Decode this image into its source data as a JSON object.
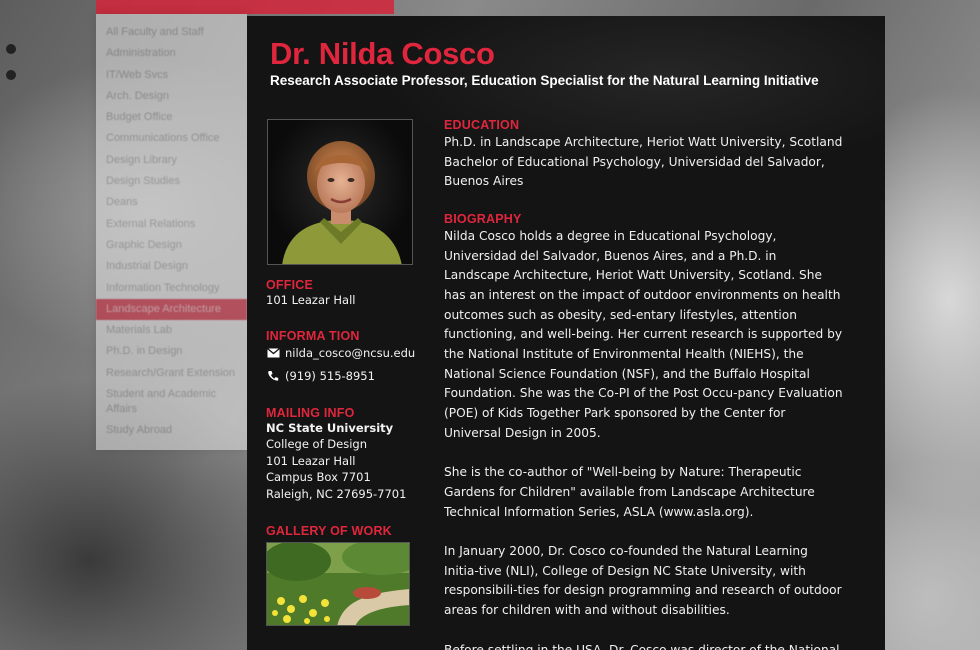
{
  "profile": {
    "name": "Dr. Nilda Cosco",
    "title": "Research Associate Professor, Education Specialist for the Natural Learning Initiative"
  },
  "sidebar": {
    "items": [
      "All Faculty and Staff",
      "Administration",
      "IT/Web Svcs",
      "Arch. Design",
      "Budget Office",
      "Communications Office",
      "Design Library",
      "Design Studies",
      "Deans",
      "External Relations",
      "Graphic Design",
      "Industrial Design",
      "Information Technology",
      "Landscape Architecture",
      "Materials Lab",
      "Ph.D. in Design",
      "Research/Grant Extension",
      "Student and Academic Affairs",
      "Study Abroad"
    ],
    "active_index": 13
  },
  "left": {
    "office_heading": "OFFICE",
    "office_value": "101 Leazar Hall",
    "info_heading": "INFORMA TION",
    "email": "nilda_cosco@ncsu.edu",
    "phone": "(919) 515-8951",
    "mailing_heading": "MAILING INFO",
    "mailing_lines": [
      "NC State University",
      "College of Design",
      "101 Leazar Hall",
      "Campus Box 7701",
      "Raleigh, NC 27695-7701"
    ],
    "gallery_heading": "GALLERY OF WORK"
  },
  "right": {
    "education_heading": "EDUCATION",
    "education_lines": [
      "Ph.D. in Landscape Architecture, Heriot Watt University, Scotland",
      "Bachelor of Educational Psychology, Universidad del Salvador,",
      "Buenos Aires"
    ],
    "biography_heading": "BIOGRAPHY",
    "bio_paragraphs": [
      "Nilda Cosco holds a degree in Educational Psychology, Universidad del Salvador, Buenos Aires, and a Ph.D. in Landscape Architecture, Heriot Watt University, Scotland. She has an interest on the impact of outdoor environments on health outcomes such as obesity, sed-entary lifestyles, attention functioning, and well-being. Her current research is supported by the National Institute of Environmental Health (NIEHS), the National Science Foundation (NSF), and the Buffalo Hospital Foundation. She was the Co-PI of the Post Occu-pancy Evaluation (POE) of Kids Together Park sponsored by the Center for Universal Design in 2005.",
      "She is the co-author of \"Well-being by Nature: Therapeutic Gardens for Children\" available from Landscape Architecture Technical Information Series, ASLA (www.asla.org).",
      "In January 2000, Dr. Cosco co-founded the Natural Learning Initia-tive (NLI), College of Design NC State University, with responsibili-ties for design programming and research of outdoor areas for children with and without disabilities.",
      "Before settling in the USA, Dr. Cosco was director of the National"
    ]
  },
  "colors": {
    "accent": "#e0263d",
    "panel": "#141414",
    "text": "#f0f0f0"
  },
  "icons": {
    "email": "envelope-icon",
    "phone": "phone-icon"
  }
}
